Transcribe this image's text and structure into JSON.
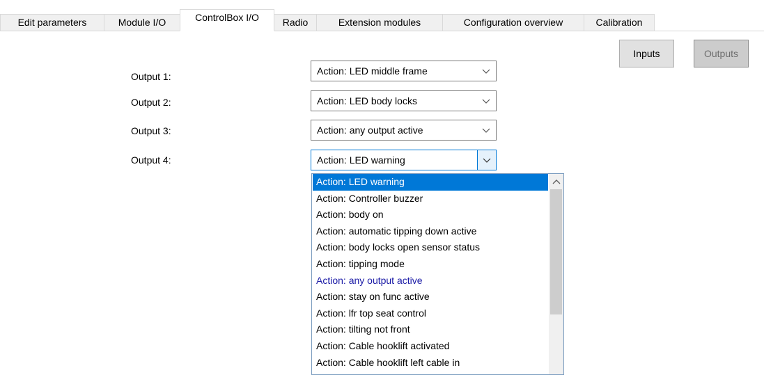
{
  "tabs": [
    {
      "label": "Edit parameters"
    },
    {
      "label": "Module I/O"
    },
    {
      "label": "ControlBox I/O"
    },
    {
      "label": "Radio"
    },
    {
      "label": "Extension modules"
    },
    {
      "label": "Configuration overview"
    },
    {
      "label": "Calibration"
    }
  ],
  "active_tab": "ControlBox I/O",
  "toggle": {
    "inputs_label": "Inputs",
    "outputs_label": "Outputs",
    "selected": "Outputs"
  },
  "outputs": [
    {
      "label": "Output 1:",
      "value": "Action: LED middle frame"
    },
    {
      "label": "Output 2:",
      "value": "Action: LED body locks"
    },
    {
      "label": "Output 3:",
      "value": "Action: any output active"
    },
    {
      "label": "Output 4:",
      "value": "Action: LED warning"
    }
  ],
  "dropdown": {
    "selected_index": 0,
    "current_value_index": 6,
    "options": [
      "Action: LED warning",
      "Action: Controller buzzer",
      "Action: body on",
      "Action: automatic tipping down active",
      "Action: body locks open sensor status",
      "Action: tipping mode",
      "Action: any output active",
      "Action: stay on func active",
      "Action: lfr top seat control",
      "Action: tilting not front",
      "Action: Cable hooklift activated",
      "Action: Cable hooklift left cable in"
    ]
  },
  "colors": {
    "selection": "#0078d7",
    "focus_border": "#0078d7",
    "current_item_text": "#1a1aa6"
  }
}
